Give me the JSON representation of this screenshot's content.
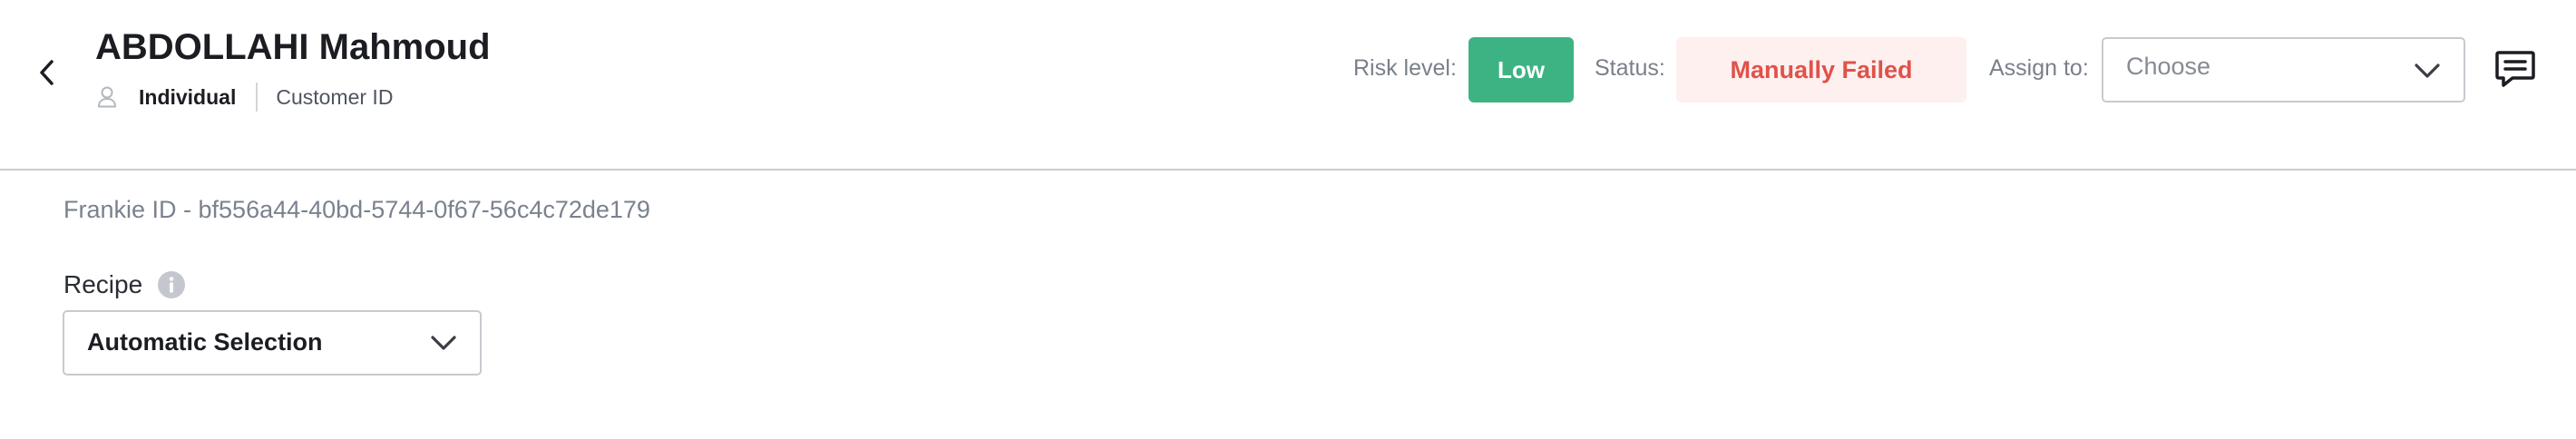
{
  "header": {
    "back_icon": "chevron-left-icon",
    "entity_name": "ABDOLLAHI Mahmoud",
    "entity_type_icon": "person-icon",
    "entity_type": "Individual",
    "customer_id_label": "Customer ID",
    "risk_level_label": "Risk level:",
    "risk_level_value": "Low",
    "status_label": "Status:",
    "status_value": "Manually Failed",
    "assign_label": "Assign to:",
    "assign_placeholder": "Choose",
    "comment_icon": "comment-icon",
    "colors": {
      "risk_low": "#3db384",
      "status_failed_text": "#e0524a",
      "status_failed_bg": "#fdf0ef"
    }
  },
  "main": {
    "frankie_id": "Frankie ID - bf556a44-40bd-5744-0f67-56c4c72de179",
    "recipe_label": "Recipe",
    "recipe_info_icon": "info-icon",
    "recipe_value": "Automatic Selection"
  }
}
